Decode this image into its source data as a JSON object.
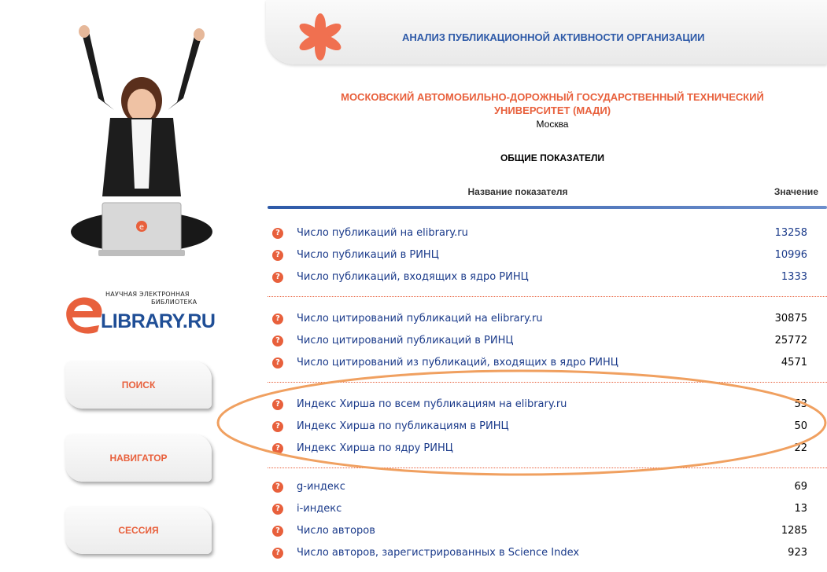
{
  "header": {
    "title": "АНАЛИЗ ПУБЛИКАЦИОННОЙ АКТИВНОСТИ ОРГАНИЗАЦИИ"
  },
  "logo": {
    "line1": "НАУЧНАЯ ЭЛЕКТРОННАЯ",
    "line2": "БИБЛИОТЕКА",
    "brand": "LIBRARY.RU"
  },
  "nav": {
    "search": "ПОИСК",
    "navigator": "НАВИГАТОР",
    "session": "СЕССИЯ"
  },
  "organization": {
    "name_line1": "МОСКОВСКИЙ АВТОМОБИЛЬНО-ДОРОЖНЫЙ ГОСУДАРСТВЕННЫЙ ТЕХНИЧЕСКИЙ",
    "name_line2": "УНИВЕРСИТЕТ (МАДИ)",
    "city": "Москва"
  },
  "section_title": "ОБЩИЕ ПОКАЗАТЕЛИ",
  "table": {
    "col_name": "Название показателя",
    "col_value": "Значение",
    "rows": [
      {
        "label": "Число публикаций на elibrary.ru",
        "value": "13258"
      },
      {
        "label": "Число публикаций в РИНЦ",
        "value": "10996"
      },
      {
        "label": "Число публикаций, входящих в ядро РИНЦ",
        "value": "1333"
      },
      {
        "label": "Число цитирований публикаций на elibrary.ru",
        "value": "30875"
      },
      {
        "label": "Число цитирований публикаций в РИНЦ",
        "value": "25772"
      },
      {
        "label": "Число цитирований из публикаций, входящих в ядро РИНЦ",
        "value": "4571"
      },
      {
        "label": "Индекс Хирша по всем публикациям на elibrary.ru",
        "value": "53"
      },
      {
        "label": "Индекс Хирша по публикациям в РИНЦ",
        "value": "50"
      },
      {
        "label": "Индекс Хирша по ядру РИНЦ",
        "value": "22"
      },
      {
        "label": "g-индекс",
        "value": "69"
      },
      {
        "label": "i-индекс",
        "value": "13"
      },
      {
        "label": "Число авторов",
        "value": "1285"
      },
      {
        "label": "Число авторов, зарегистрированных в Science Index",
        "value": "923"
      }
    ]
  },
  "colors": {
    "accent": "#e8603c",
    "link": "#1a3a8a",
    "brand_blue": "#2e5aa8",
    "highlight": "#f0a060"
  },
  "icons": {
    "help": "question-circle-icon"
  }
}
